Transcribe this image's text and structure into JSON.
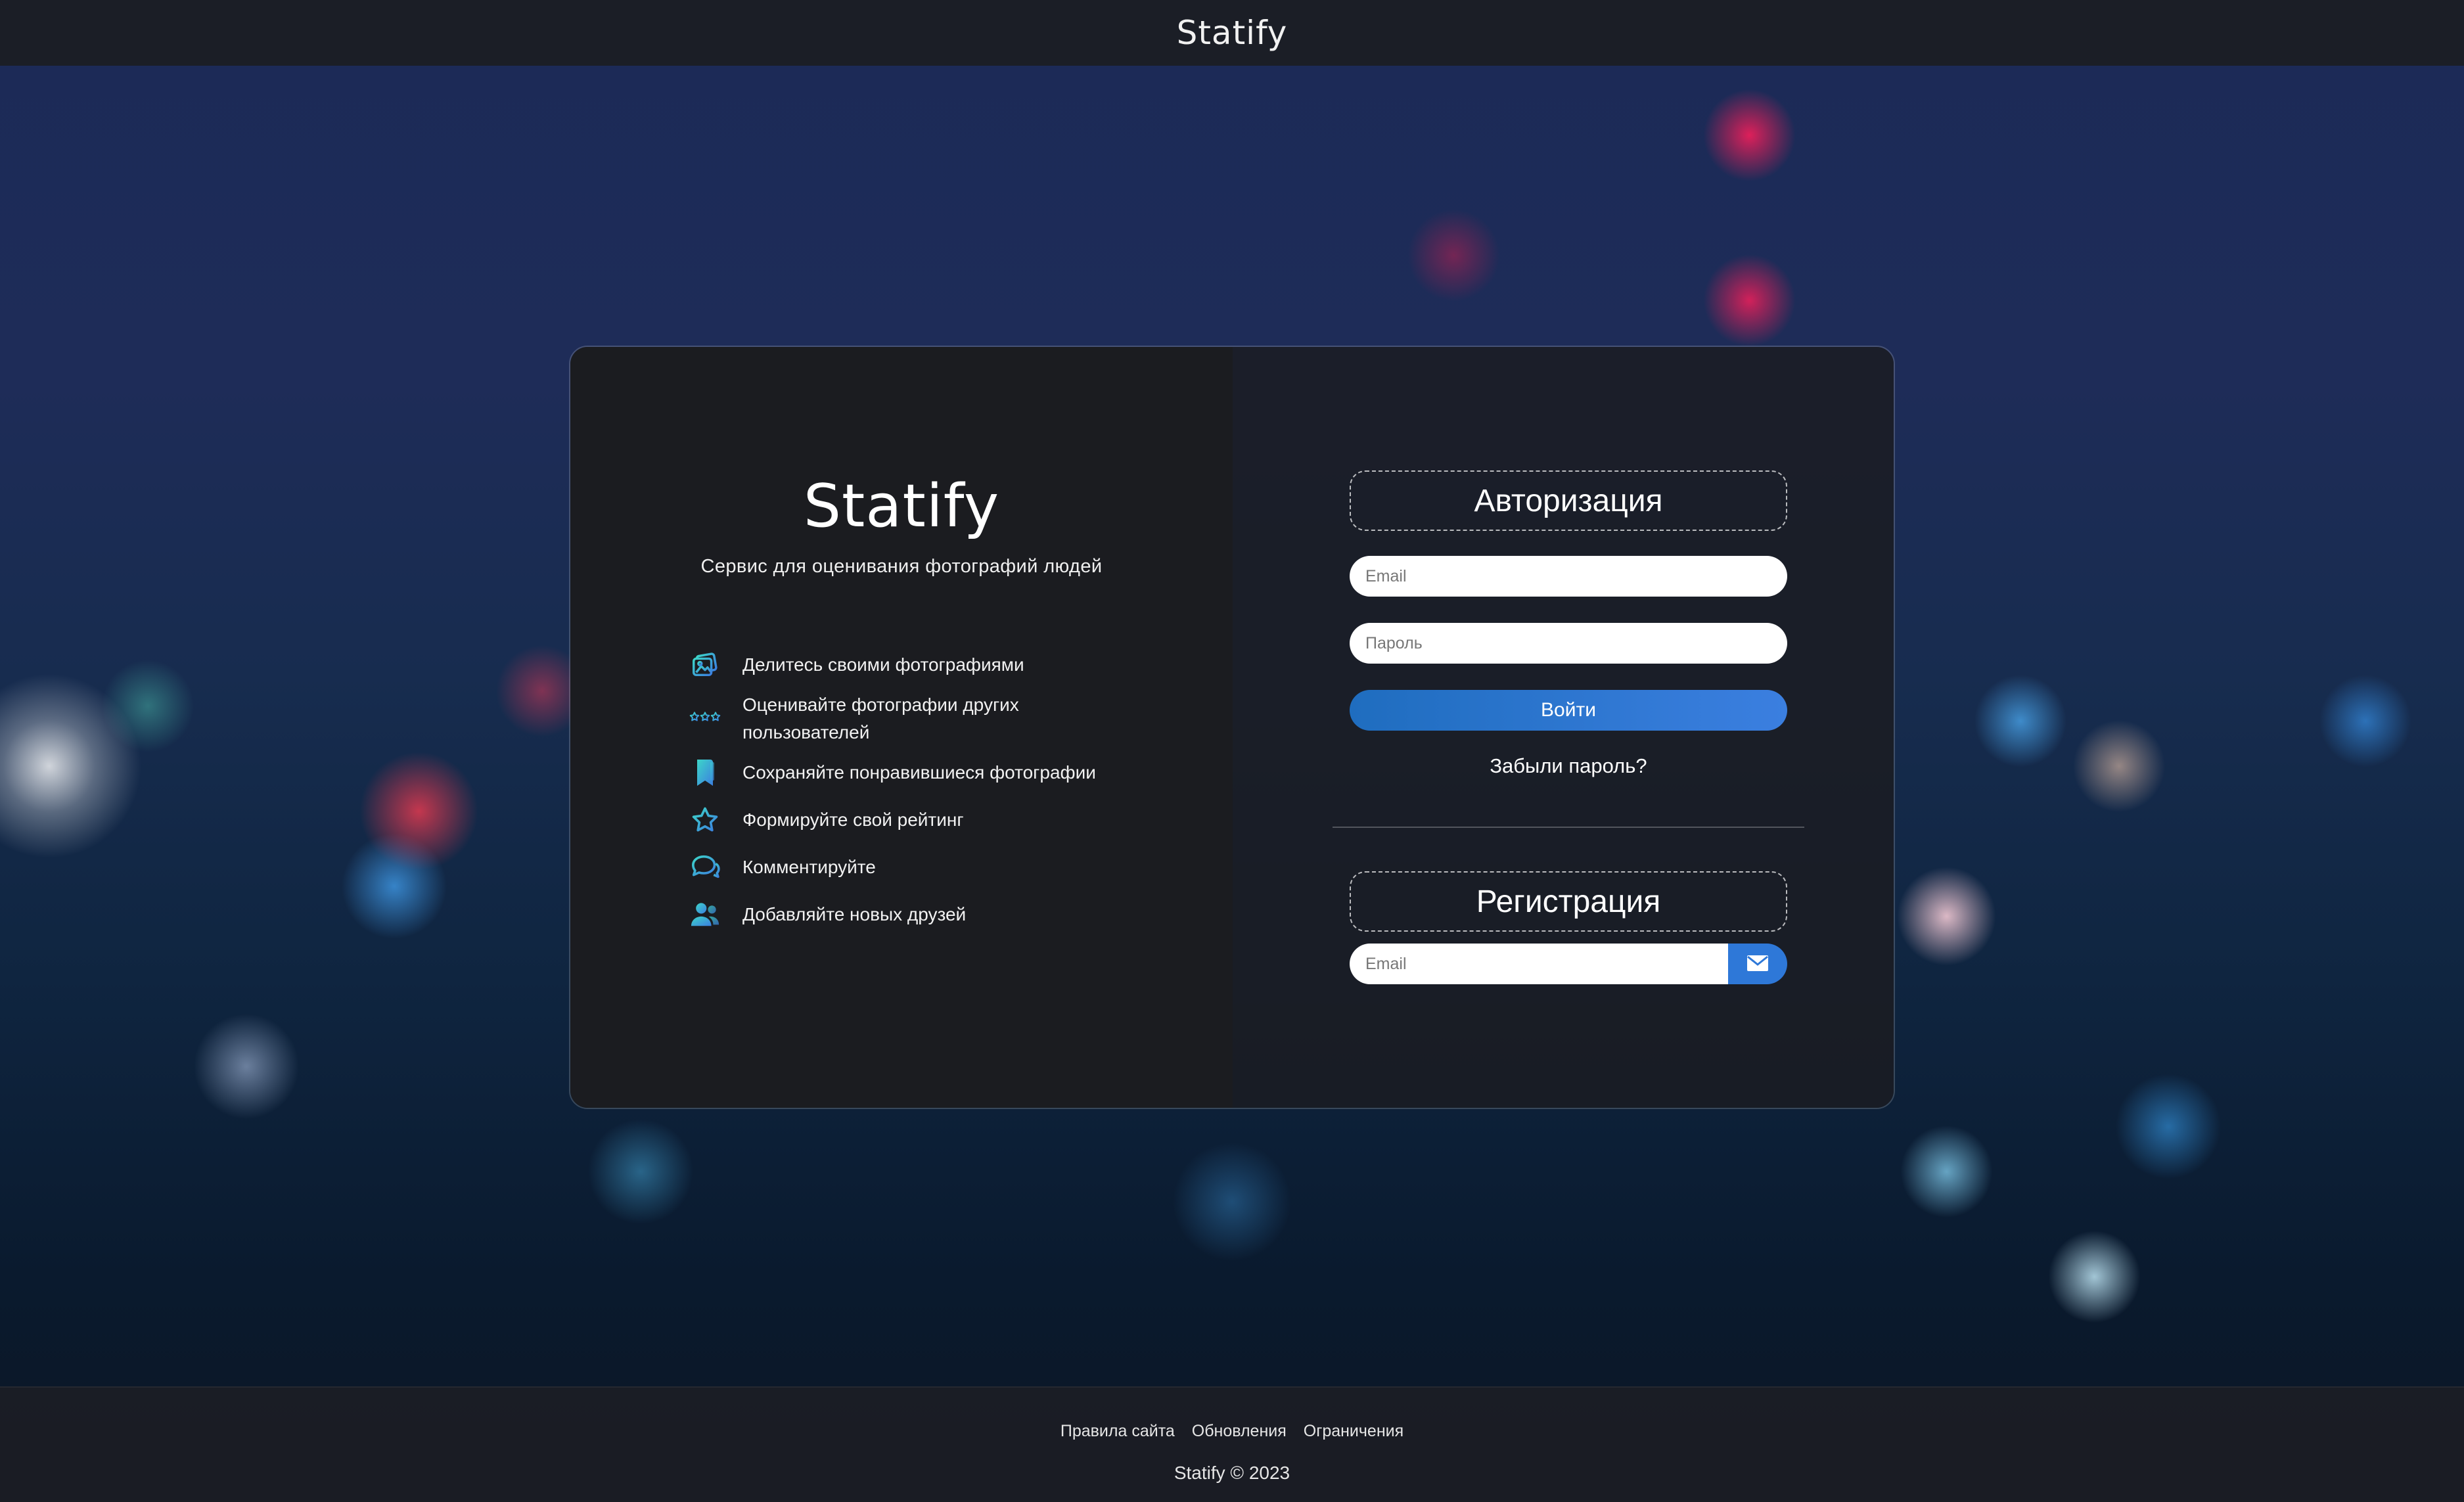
{
  "header": {
    "brand": "Statify"
  },
  "promo": {
    "brand": "Statify",
    "tagline": "Сервис для оценивания фотографий людей",
    "features": [
      {
        "icon": "photos-icon",
        "text": "Делитесь своими фотографиями"
      },
      {
        "icon": "rating-stars-icon",
        "text": "Оценивайте фотографии других пользователей"
      },
      {
        "icon": "bookmark-icon",
        "text": "Сохраняйте понравившиеся фотографии"
      },
      {
        "icon": "star-icon",
        "text": "Формируйте свой рейтинг"
      },
      {
        "icon": "comments-icon",
        "text": "Комментируйте"
      },
      {
        "icon": "friends-icon",
        "text": "Добавляйте новых друзей"
      }
    ]
  },
  "auth": {
    "title": "Авторизация",
    "email_placeholder": "Email",
    "email_value": "",
    "password_placeholder": "Пароль",
    "password_value": "",
    "login_label": "Войти",
    "forgot_label": "Забыли пароль?"
  },
  "register": {
    "title": "Регистрация",
    "email_placeholder": "Email",
    "email_value": "",
    "submit_icon": "envelope-icon"
  },
  "footer": {
    "links": [
      "Правила сайта",
      "Обновления",
      "Ограничения"
    ],
    "copyright": "Statify © 2023"
  },
  "colors": {
    "accent": "#2e78d8",
    "icon_gradient_start": "#3dd5c8",
    "icon_gradient_end": "#3b7fe0",
    "panel": "#1b1c20",
    "topbar": "#1b1e26"
  }
}
